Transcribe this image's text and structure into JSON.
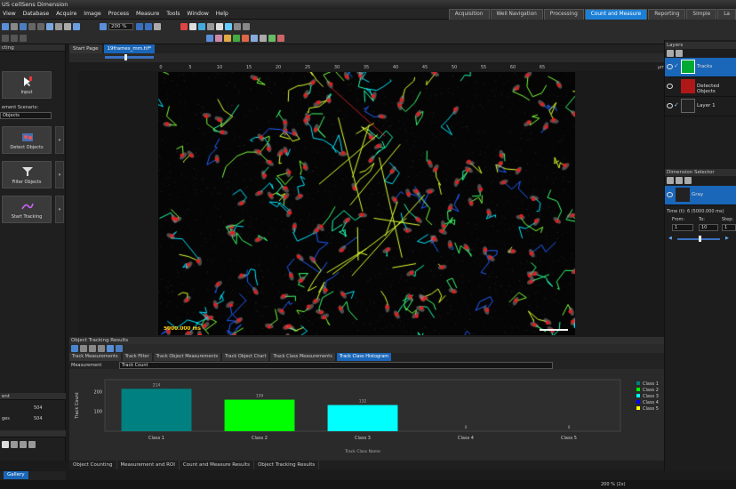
{
  "app": {
    "title": "US cellSens Dimension"
  },
  "menu": [
    "View",
    "Database",
    "Acquire",
    "Image",
    "Process",
    "Measure",
    "Tools",
    "Window",
    "Help"
  ],
  "workspace_tabs": [
    {
      "label": "Acquisition",
      "active": false
    },
    {
      "label": "Well Navigation",
      "active": false
    },
    {
      "label": "Processing",
      "active": false
    },
    {
      "label": "Count and Measure",
      "active": true
    },
    {
      "label": "Reporting",
      "active": false
    },
    {
      "label": "Simple",
      "active": false
    },
    {
      "label": "La",
      "active": false
    }
  ],
  "toolbar": {
    "zoom": "200 %"
  },
  "left_panel": {
    "header": "cting",
    "scenario_label": "ement Scenario:",
    "scenario_value": "Objects",
    "buttons": [
      {
        "label": "Input",
        "icon": "cursor-icon"
      },
      {
        "label": "Detect Objects",
        "icon": "detect-objects-icon"
      },
      {
        "label": "Filter Objects",
        "icon": "filter-icon"
      },
      {
        "label": "Start Tracking",
        "icon": "tracking-icon"
      }
    ],
    "count_header": "ent",
    "count_rows": [
      {
        "label": "",
        "value": "504"
      },
      {
        "label": "ges",
        "value": "504"
      }
    ]
  },
  "doc_tabs": [
    {
      "label": "Start Page",
      "active": false
    },
    {
      "label": "19frames_mm.tif*",
      "active": true
    }
  ],
  "ruler_ticks": [
    "0",
    "5",
    "10",
    "15",
    "20",
    "25",
    "30",
    "35",
    "40",
    "45",
    "50",
    "55",
    "60",
    "65"
  ],
  "ruler_unit": "µm",
  "image": {
    "timestamp": "5000.000 ms"
  },
  "results_panel": {
    "title": "Object Tracking Results",
    "tabs": [
      {
        "label": "Track Measurements",
        "active": false
      },
      {
        "label": "Track Filter",
        "active": false
      },
      {
        "label": "Track Object Measurements",
        "active": false
      },
      {
        "label": "Track Object Chart",
        "active": false
      },
      {
        "label": "Track Class Measurements",
        "active": false
      },
      {
        "label": "Track Class Histogram",
        "active": true
      }
    ],
    "measurement_label": "Measurement",
    "measurement_value": "Track Count"
  },
  "chart_data": {
    "type": "bar",
    "categories": [
      "Class 1",
      "Class 2",
      "Class 3",
      "Class 4",
      "Class 5"
    ],
    "values": [
      214,
      159,
      132,
      0,
      0
    ],
    "xlabel": "Track Class Name",
    "ylabel": "Track Count",
    "yticks": [
      100,
      200
    ],
    "ylim": [
      0,
      260
    ],
    "legend": [
      "Class 1",
      "Class 2",
      "Class 3",
      "Class 4",
      "Class 5"
    ],
    "colors": [
      "#008080",
      "#00ff00",
      "#00ffff",
      "#0000ff",
      "#ffff00"
    ],
    "legend_position": "right"
  },
  "bottom_tabs": [
    "Object Counting",
    "Measurement and ROI",
    "Count and Measure Results",
    "Object Tracking Results"
  ],
  "gallery_label": "Gallery",
  "layers_panel": {
    "title": "Layers",
    "layers": [
      {
        "name": "Tracks",
        "active": true
      },
      {
        "name": "Detected Objects",
        "active": false
      },
      {
        "name": "Layer 1",
        "active": false
      }
    ]
  },
  "dimension_selector": {
    "title": "Dimension Selector",
    "item": "Gray",
    "time_label": "Time (t): 6 (5000.000 ms)",
    "from_label": "From:",
    "from": "1",
    "to_label": "To:",
    "to": "10",
    "step_label": "Step:",
    "step": "1"
  },
  "status": {
    "zoom": "200 % (2x)"
  }
}
